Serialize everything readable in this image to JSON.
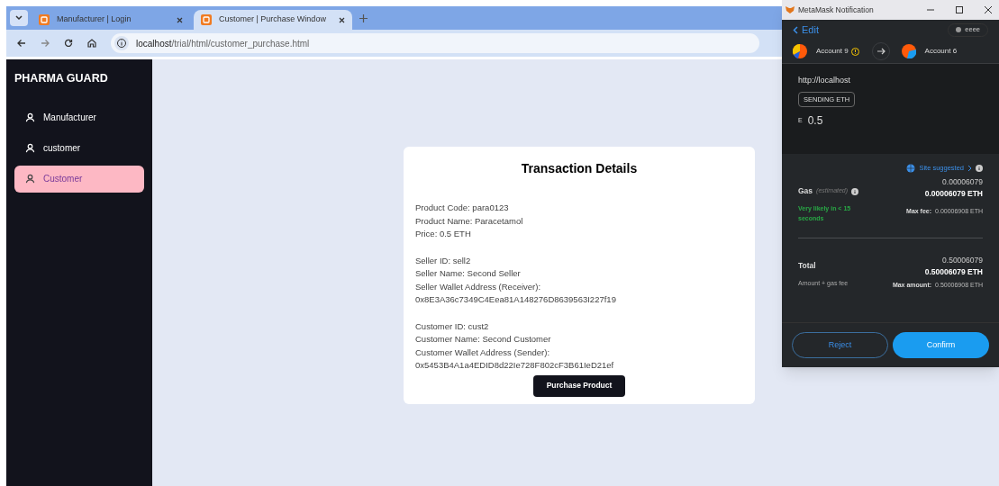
{
  "browser": {
    "tabs": [
      {
        "title": "Manufacturer | Login",
        "selected": false
      },
      {
        "title": "Customer | Purchase Window",
        "selected": true
      }
    ],
    "url": {
      "host": "localhost",
      "path": "/trial/html/customer_purchase.html"
    }
  },
  "sidebar": {
    "brand": "PHARMA GUARD",
    "items": [
      {
        "label": "Manufacturer",
        "selected": false
      },
      {
        "label": "customer",
        "selected": false
      },
      {
        "label": "Customer",
        "selected": true
      }
    ]
  },
  "card": {
    "title": "Transaction Details",
    "groups": [
      [
        "Product Code: para0123",
        "Product Name: Paracetamol",
        "Price: 0.5 ETH"
      ],
      [
        "Seller ID: sell2",
        "Seller Name: Second Seller",
        "Seller Wallet Address (Receiver):",
        "0x8E3A36c7349C4Eea81A148276D8639563I227f19"
      ],
      [
        "Customer ID: cust2",
        "Customer Name: Second Customer",
        "Customer Wallet Address (Sender):",
        "0x5453B4A1a4EDID8d22Ie728F802cF3B61IeD21ef"
      ]
    ],
    "button": "Purchase Product"
  },
  "metamask": {
    "title": "MetaMask Notification",
    "back": "Edit",
    "network": "eeee",
    "from": "Account 9",
    "to": "Account 6",
    "origin": "http://localhost",
    "badge": "SENDING ETH",
    "amount_symbol": "Ε",
    "amount": "0.5",
    "site_suggested": "Site suggested",
    "gas": {
      "label": "Gas",
      "note": "(estimated)",
      "value": "0.00006079",
      "value_eth": "0.00006079 ETH",
      "speed": "Very likely in < 15 seconds",
      "max_label": "Max fee:",
      "max_value": "0.00006908 ETH"
    },
    "total": {
      "label": "Total",
      "value": "0.50006079",
      "value_eth": "0.50006079 ETH",
      "sub": "Amount + gas fee",
      "max_label": "Max amount:",
      "max_value": "0.50006908 ETH"
    },
    "buttons": [
      "Reject",
      "Confirm"
    ]
  }
}
